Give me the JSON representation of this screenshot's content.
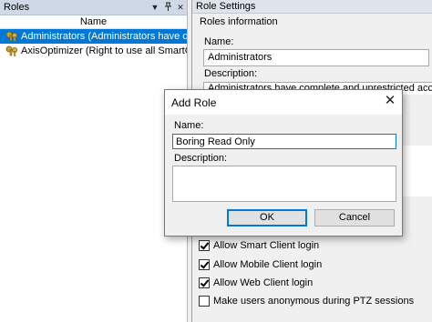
{
  "roles_pane": {
    "title": "Roles",
    "column_header": "Name",
    "items": [
      {
        "label": "Administrators (Administrators have co",
        "selected": true
      },
      {
        "label": "AxisOptimizer (Right to use all SmartCli",
        "selected": false
      }
    ]
  },
  "settings_pane": {
    "title": "Role Settings",
    "group_label": "Roles information",
    "name_label": "Name:",
    "name_value": "Administrators",
    "description_label": "Description:",
    "description_value": "Administrators have complete and unrestricted access to t",
    "checkboxes": [
      {
        "label": "Allow Smart Client login",
        "checked": true
      },
      {
        "label": "Allow Mobile Client login",
        "checked": true
      },
      {
        "label": "Allow Web Client login",
        "checked": true
      },
      {
        "label": "Make users anonymous during PTZ sessions",
        "checked": false
      }
    ]
  },
  "dialog": {
    "title": "Add Role",
    "name_label": "Name:",
    "name_value": "Boring Read Only",
    "description_label": "Description:",
    "description_value": "",
    "ok_label": "OK",
    "cancel_label": "Cancel"
  },
  "colors": {
    "selection": "#0078d7",
    "focus_border": "#0078d7",
    "key_icon": "#c8a02a"
  },
  "icons": {
    "close": "close-icon",
    "dropdown": "chevron-down-icon",
    "pin": "pin-icon",
    "role": "key-icon"
  }
}
